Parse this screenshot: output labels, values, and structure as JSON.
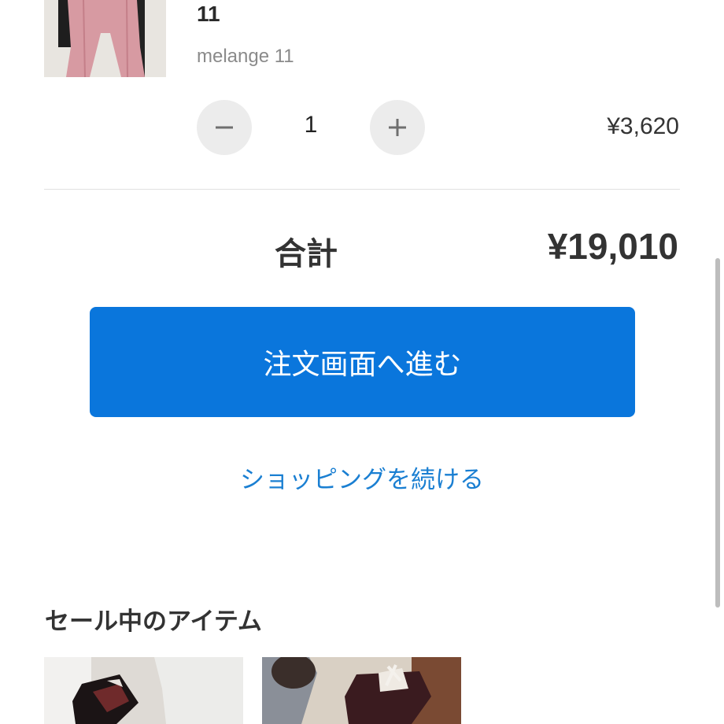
{
  "cart_item": {
    "name": "11",
    "variant": "melange 11",
    "quantity": "1",
    "price": "¥3,620"
  },
  "summary": {
    "total_label": "合計",
    "total_value": "¥19,010"
  },
  "actions": {
    "checkout_label": "注文画面へ進む",
    "continue_label": "ショッピングを続ける"
  },
  "sale_section": {
    "title": "セール中のアイテム"
  },
  "colors": {
    "accent": "#0a76dc",
    "link": "#1a7fd2"
  },
  "icons": {
    "decrease": "minus-icon",
    "increase": "plus-icon"
  }
}
